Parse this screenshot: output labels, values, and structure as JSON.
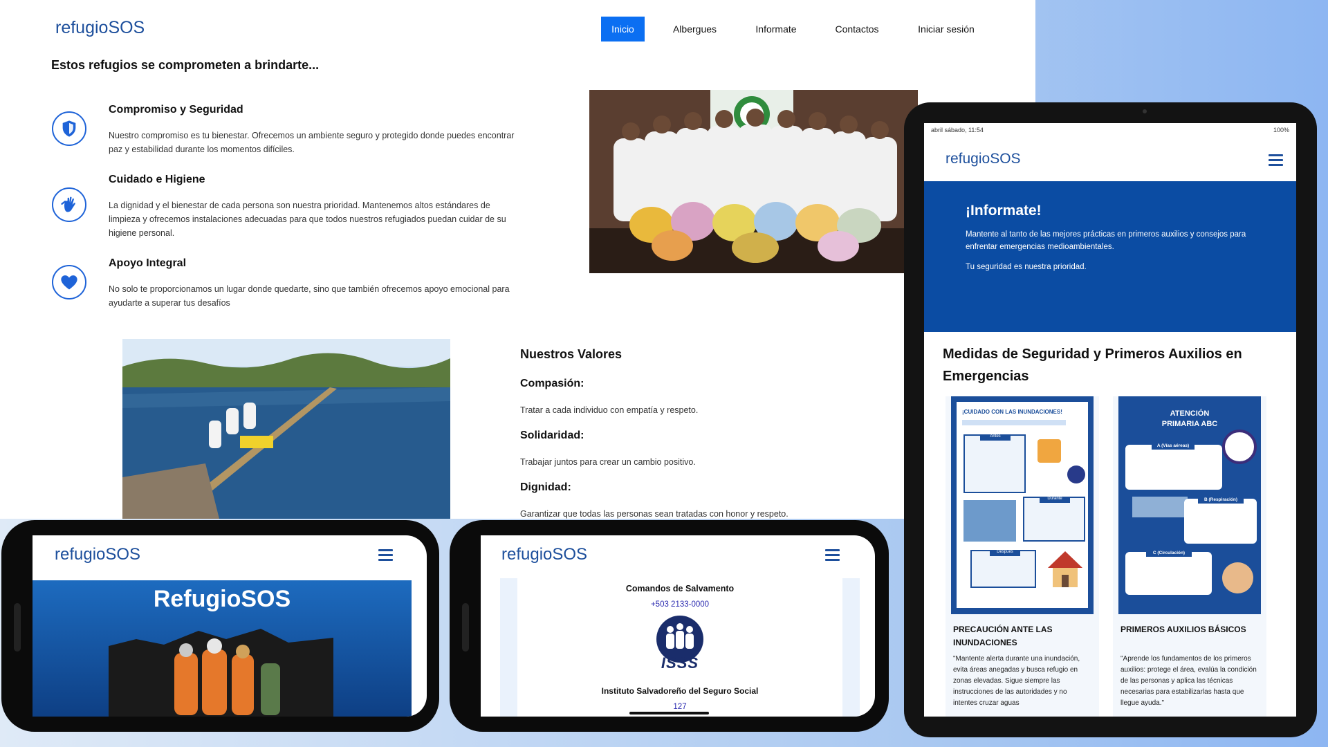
{
  "brand": "refugioSOS",
  "desktop": {
    "nav": [
      "Inicio",
      "Albergues",
      "Informate",
      "Contactos",
      "Iniciar sesión"
    ],
    "heading": "Estos refugios se comprometen a brindarte...",
    "features": [
      {
        "title": "Compromiso y Seguridad",
        "desc": "Nuestro compromiso es tu bienestar. Ofrecemos un ambiente seguro y protegido donde puedes encontrar paz y estabilidad durante los momentos difíciles."
      },
      {
        "title": "Cuidado e Higiene",
        "desc": "La dignidad y el bienestar de cada persona son nuestra prioridad. Mantenemos altos estándares de limpieza y ofrecemos instalaciones adecuadas para que todos nuestros refugiados puedan cuidar de su higiene personal."
      },
      {
        "title": "Apoyo Integral",
        "desc": "No solo te proporcionamos un lugar donde quedarte, sino que también ofrecemos apoyo emocional para ayudarte a superar tus desafíos"
      }
    ],
    "values_title": "Nuestros Valores",
    "values": [
      {
        "title": "Compasión:",
        "desc": "Tratar a cada individuo con empatía y respeto."
      },
      {
        "title": "Solidaridad:",
        "desc": "Trabajar juntos para crear un cambio positivo."
      },
      {
        "title": "Dignidad:",
        "desc": "Garantizar que todas las personas sean tratadas con honor y respeto."
      }
    ]
  },
  "tablet": {
    "status_left": "abril sábado, 11:54",
    "status_right": "100%",
    "hero_title": "¡Informate!",
    "hero_p1": "Mantente al tanto de las mejores prácticas en primeros auxilios y consejos para enfrentar emergencias medioambientales.",
    "hero_p2": "Tu seguridad es nuestra prioridad.",
    "section_title": "Medidas de Seguridad y Primeros Auxilios en Emergencias",
    "cards": [
      {
        "poster_title": "¡CUIDADO CON LAS INUNDACIONES!",
        "title": "PRECAUCIÓN ANTE LAS INUNDACIONES",
        "desc": "\"Mantente alerta durante una inundación, evita áreas anegadas y busca refugio en zonas elevadas. Sigue siempre las instrucciones de las autoridades y no intentes cruzar aguas"
      },
      {
        "poster_title": "ATENCIÓN PRIMARIA ABC",
        "title": "PRIMEROS AUXILIOS BÁSICOS",
        "desc": "\"Aprende los fundamentos de los primeros auxilios: protege el área, evalúa la condición de las personas y aplica las técnicas necesarias para estabilizarlas hasta que llegue ayuda.\""
      }
    ],
    "poster_labels": [
      "Antes",
      "Durante",
      "Después",
      "A (Vías aéreas)",
      "B (Respiración)",
      "C (Circulación)"
    ]
  },
  "phone1": {
    "hero_title": "RefugioSOS"
  },
  "phone2": {
    "contact_name": "Comandos de Salvamento",
    "contact_phone": "+503 2133-0000",
    "logo_text": "ISSS",
    "org_name": "Instituto Salvadoreño del Seguro Social",
    "org_phone": "127"
  },
  "colors": {
    "accent": "#0b6ff2",
    "brand": "#1d4f9c",
    "hero_blue": "#0b4ca3"
  },
  "icons": [
    "shield-icon",
    "hands-icon",
    "heart-icon",
    "hamburger-menu-icon"
  ]
}
